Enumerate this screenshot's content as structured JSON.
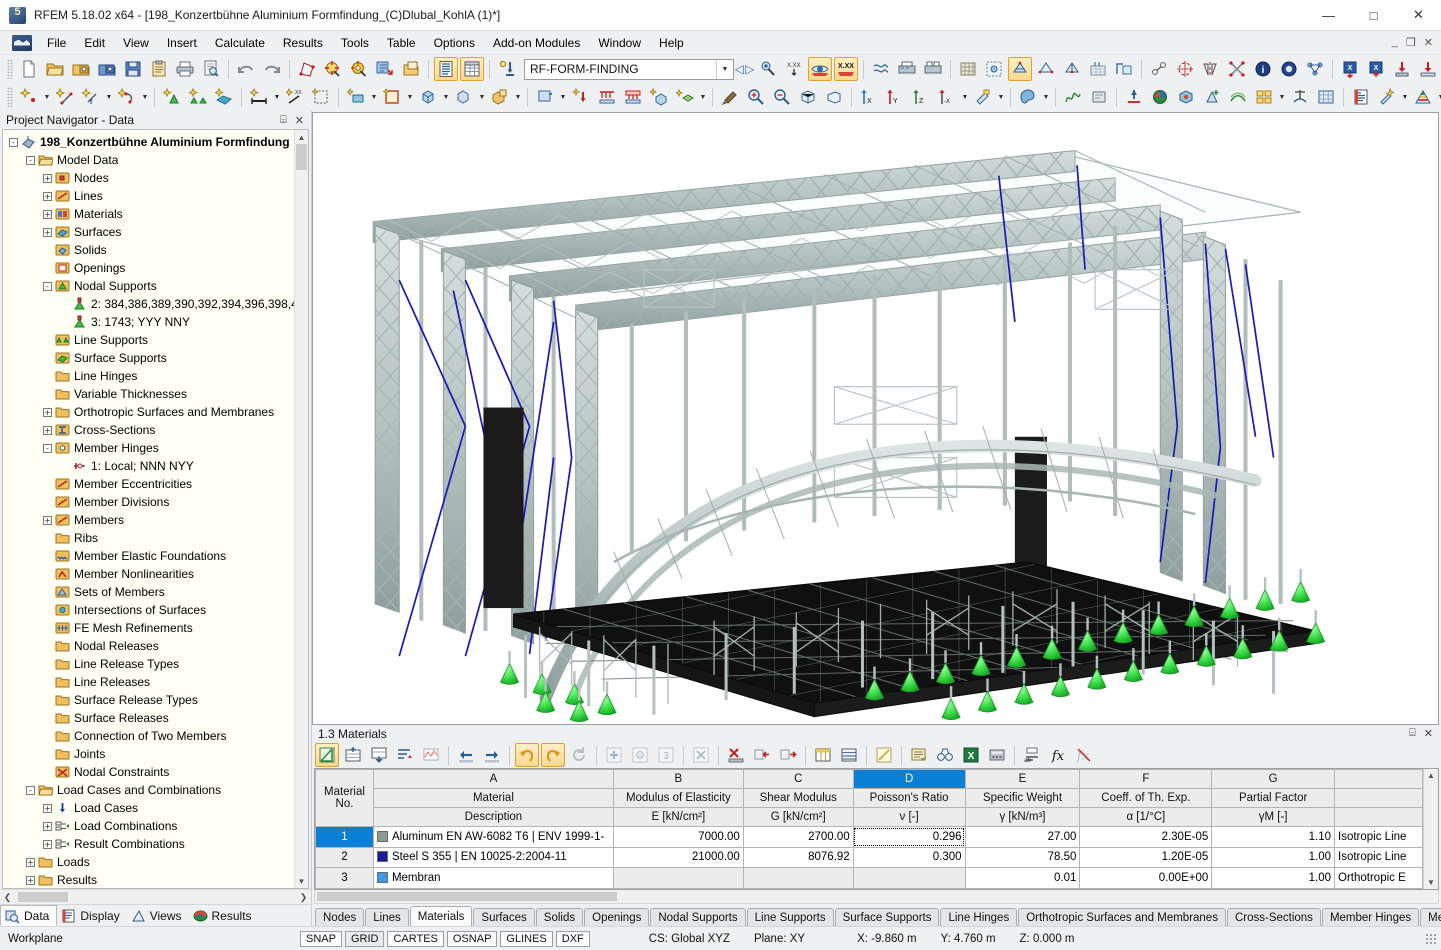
{
  "window": {
    "title": "RFEM 5.18.02 x64 - [198_Konzertbühne Aluminium Formfindung_(C)Dlubal_KohlA (1)*]",
    "minimize": "—",
    "maximize": "□",
    "close": "✕",
    "mdi_minimize": "_",
    "mdi_restore": "❐",
    "mdi_close": "✕"
  },
  "menu": {
    "items": [
      {
        "label": "File"
      },
      {
        "label": "Edit"
      },
      {
        "label": "View"
      },
      {
        "label": "Insert"
      },
      {
        "label": "Calculate"
      },
      {
        "label": "Results"
      },
      {
        "label": "Tools"
      },
      {
        "label": "Table"
      },
      {
        "label": "Options"
      },
      {
        "label": "Add-on Modules"
      },
      {
        "label": "Window"
      },
      {
        "label": "Help"
      }
    ]
  },
  "toolbar": {
    "loadcase_combo": "RF-FORM-FINDING",
    "row1_icons": [
      "new-file-icon",
      "open-folder-icon",
      "open-model-icon",
      "save-as-model-icon",
      "save-icon",
      "clipboard-icon",
      "print-icon",
      "print-preview-icon",
      "undo-icon",
      "redo-icon",
      "edit-model-icon",
      "select-node-icon",
      "circle-select-icon",
      "select-import-icon",
      "detail-icon",
      "tables-icon",
      "table-grid-icon",
      "load-wizard-icon"
    ],
    "row1_right_icons": [
      "prev-case-icon",
      "next-case-icon",
      "render-icon",
      "numeric-value-icon",
      "display-result-icon",
      "result-value-icon",
      "wind-simulation-icon",
      "printout-report-icon",
      "printout-list-icon",
      "mesh-icon",
      "mesh-settings-icon",
      "fe-mesh-icon",
      "calc-mesh-icon",
      "calc-all-icon",
      "calc-select-icon",
      "calc-diagram-icon",
      "snap-icon",
      "rotate-icon",
      "mirror-icon",
      "select-cross-icon",
      "info-icon",
      "check-icon",
      "network-icon",
      "export-xls-icon",
      "export-xls2-icon",
      "import-icon",
      "import2-icon"
    ],
    "row2_icons": [
      "new-node-icon",
      "new-line-icon",
      "new-dimension-icon",
      "new-polygon-icon",
      "new-nodal-support-icon",
      "new-line-support-icon",
      "new-surface-icon",
      "new-member-icon",
      "new-member-xx-icon",
      "new-select-region-icon",
      "new-surface-obj-icon",
      "new-opening-icon",
      "new-solid-icon",
      "new-solid-group-icon",
      "new-block-icon",
      "new-load-icon",
      "new-nodal-load-icon",
      "new-line-load-icon",
      "new-surface-load-icon",
      "new-free-load-icon",
      "new-loadwizard-icon",
      "cleanup-icon",
      "zoom-in-icon",
      "zoom-out-icon",
      "view-box-icon",
      "view-persp-icon",
      "axis-x-icon",
      "axis-y-icon",
      "axis-z-icon",
      "axis-xy-icon",
      "render-mode-icon",
      "paint-icon",
      "deform-icon",
      "time-icon",
      "support-reaction-icon",
      "color-result-icon",
      "solid-result-icon",
      "add-result-icon",
      "iso-result-icon",
      "panel-result-icon",
      "mesh-result-icon",
      "grid-result-icon",
      "report-icon",
      "settings-icon",
      "color-scale-icon"
    ]
  },
  "navigator": {
    "title": "Project Navigator - Data",
    "pin": "⌸",
    "close": "✕",
    "tree": [
      {
        "depth": 0,
        "toggle": "-",
        "icon": "model-icon",
        "label": "198_Konzertbühne Aluminium Formfindung",
        "bold": true
      },
      {
        "depth": 1,
        "toggle": "-",
        "icon": "folder-open-icon",
        "label": "Model Data"
      },
      {
        "depth": 2,
        "toggle": "+",
        "icon": "nodes-icon",
        "label": "Nodes"
      },
      {
        "depth": 2,
        "toggle": "+",
        "icon": "lines-icon",
        "label": "Lines"
      },
      {
        "depth": 2,
        "toggle": "+",
        "icon": "materials-icon",
        "label": "Materials"
      },
      {
        "depth": 2,
        "toggle": "+",
        "icon": "surfaces-icon",
        "label": "Surfaces"
      },
      {
        "depth": 2,
        "toggle": "",
        "icon": "solids-icon",
        "label": "Solids"
      },
      {
        "depth": 2,
        "toggle": "",
        "icon": "openings-icon",
        "label": "Openings"
      },
      {
        "depth": 2,
        "toggle": "-",
        "icon": "nodal-supports-icon",
        "label": "Nodal Supports"
      },
      {
        "depth": 3,
        "toggle": "",
        "icon": "support-item-icon",
        "label": "2: 384,386,389,390,392,394,396,398,4"
      },
      {
        "depth": 3,
        "toggle": "",
        "icon": "support-item-icon",
        "label": "3: 1743; YYY NNY"
      },
      {
        "depth": 2,
        "toggle": "",
        "icon": "line-supports-icon",
        "label": "Line Supports"
      },
      {
        "depth": 2,
        "toggle": "",
        "icon": "surface-supports-icon",
        "label": "Surface Supports"
      },
      {
        "depth": 2,
        "toggle": "",
        "icon": "line-hinges-icon",
        "label": "Line Hinges"
      },
      {
        "depth": 2,
        "toggle": "",
        "icon": "variable-thicknesses-icon",
        "label": "Variable Thicknesses"
      },
      {
        "depth": 2,
        "toggle": "+",
        "icon": "orthotropic-icon",
        "label": "Orthotropic Surfaces and Membranes"
      },
      {
        "depth": 2,
        "toggle": "+",
        "icon": "cross-sections-icon",
        "label": "Cross-Sections"
      },
      {
        "depth": 2,
        "toggle": "-",
        "icon": "member-hinges-icon",
        "label": "Member Hinges"
      },
      {
        "depth": 3,
        "toggle": "",
        "icon": "hinge-item-icon",
        "label": "1: Local; NNN NYY"
      },
      {
        "depth": 2,
        "toggle": "",
        "icon": "member-eccentricities-icon",
        "label": "Member Eccentricities"
      },
      {
        "depth": 2,
        "toggle": "",
        "icon": "member-divisions-icon",
        "label": "Member Divisions"
      },
      {
        "depth": 2,
        "toggle": "+",
        "icon": "members-icon",
        "label": "Members"
      },
      {
        "depth": 2,
        "toggle": "",
        "icon": "ribs-icon",
        "label": "Ribs"
      },
      {
        "depth": 2,
        "toggle": "",
        "icon": "member-elastic-foundations-icon",
        "label": "Member Elastic Foundations"
      },
      {
        "depth": 2,
        "toggle": "",
        "icon": "member-nonlinearities-icon",
        "label": "Member Nonlinearities"
      },
      {
        "depth": 2,
        "toggle": "",
        "icon": "sets-of-members-icon",
        "label": "Sets of Members"
      },
      {
        "depth": 2,
        "toggle": "",
        "icon": "intersections-icon",
        "label": "Intersections of Surfaces"
      },
      {
        "depth": 2,
        "toggle": "",
        "icon": "fe-mesh-refinements-icon",
        "label": "FE Mesh Refinements"
      },
      {
        "depth": 2,
        "toggle": "",
        "icon": "nodal-releases-icon",
        "label": "Nodal Releases"
      },
      {
        "depth": 2,
        "toggle": "",
        "icon": "line-release-types-icon",
        "label": "Line Release Types"
      },
      {
        "depth": 2,
        "toggle": "",
        "icon": "line-releases-icon",
        "label": "Line Releases"
      },
      {
        "depth": 2,
        "toggle": "",
        "icon": "surface-release-types-icon",
        "label": "Surface Release Types"
      },
      {
        "depth": 2,
        "toggle": "",
        "icon": "surface-releases-icon",
        "label": "Surface Releases"
      },
      {
        "depth": 2,
        "toggle": "",
        "icon": "connection-two-members-icon",
        "label": "Connection of Two Members"
      },
      {
        "depth": 2,
        "toggle": "",
        "icon": "joints-icon",
        "label": "Joints"
      },
      {
        "depth": 2,
        "toggle": "",
        "icon": "nodal-constraints-icon",
        "label": "Nodal Constraints"
      },
      {
        "depth": 1,
        "toggle": "-",
        "icon": "folder-open-icon",
        "label": "Load Cases and Combinations"
      },
      {
        "depth": 2,
        "toggle": "+",
        "icon": "load-cases-icon",
        "label": "Load Cases"
      },
      {
        "depth": 2,
        "toggle": "+",
        "icon": "load-combinations-icon",
        "label": "Load Combinations"
      },
      {
        "depth": 2,
        "toggle": "+",
        "icon": "result-combinations-icon",
        "label": "Result Combinations"
      },
      {
        "depth": 1,
        "toggle": "+",
        "icon": "folder-icon",
        "label": "Loads"
      },
      {
        "depth": 1,
        "toggle": "+",
        "icon": "folder-icon",
        "label": "Results"
      }
    ],
    "tabs": [
      {
        "label": "Data",
        "icon": "data-icon",
        "selected": true
      },
      {
        "label": "Display",
        "icon": "display-icon",
        "selected": false
      },
      {
        "label": "Views",
        "icon": "views-icon",
        "selected": false
      },
      {
        "label": "Results",
        "icon": "results-icon",
        "selected": false
      }
    ]
  },
  "table": {
    "title": "1.3 Materials",
    "pin": "⌸",
    "close": "✕",
    "toolbar_icons": [
      "edit-table-icon",
      "insert-row-icon",
      "move-down-icon",
      "sort-icon",
      "chart-icon",
      "prev-table-icon",
      "next-table-icon",
      "undo-table-icon",
      "redo-table-icon",
      "refresh-icon",
      "add-icon",
      "copy-icon",
      "info-row-icon",
      "delete-selected-icon",
      "delete-table-icon",
      "remove-row-icon",
      "insert-row2-icon",
      "columns-icon",
      "rows-icon",
      "edit-cell-icon",
      "print-table-icon",
      "binoculars-icon",
      "export-excel-icon",
      "calculator-icon",
      "autotext-icon",
      "formula-icon",
      "clear-formula-icon"
    ],
    "column_letters": [
      "",
      "A",
      "B",
      "C",
      "D",
      "E",
      "F",
      "G",
      ""
    ],
    "headers": [
      {
        "line1": "Material",
        "line2": "No."
      },
      {
        "line1": "Material",
        "line2": "Description"
      },
      {
        "line1": "Modulus of Elasticity",
        "line2": "E [kN/cm²]"
      },
      {
        "line1": "Shear Modulus",
        "line2": "G [kN/cm²]"
      },
      {
        "line1": "Poisson's Ratio",
        "line2": "ν [-]"
      },
      {
        "line1": "Specific Weight",
        "line2": "γ [kN/m³]"
      },
      {
        "line1": "Coeff. of Th. Exp.",
        "line2": "α [1/°C]"
      },
      {
        "line1": "Partial Factor",
        "line2": "γM [-]"
      },
      {
        "line1": "",
        "line2": ""
      }
    ],
    "selected_column": "D",
    "rows": [
      {
        "no": "1",
        "color": "#8f9a93",
        "description": "Aluminum EN AW-6082 T6 | ENV 1999-1-",
        "E": "7000.00",
        "G": "2700.00",
        "nu": "0.296",
        "gamma": "27.00",
        "alpha": "2.30E-05",
        "gammaM": "1.10",
        "model": "Isotropic Line",
        "selected": true
      },
      {
        "no": "2",
        "color": "#1a1a9c",
        "description": "Steel S 355 | EN 10025-2:2004-11",
        "E": "21000.00",
        "G": "8076.92",
        "nu": "0.300",
        "gamma": "78.50",
        "alpha": "1.20E-05",
        "gammaM": "1.00",
        "model": "Isotropic Line",
        "selected": false
      },
      {
        "no": "3",
        "color": "#3c9ae8",
        "description": "Membran",
        "E": "",
        "G": "",
        "nu": "",
        "gamma": "0.01",
        "alpha": "0.00E+00",
        "gammaM": "1.00",
        "model": "Orthotropic E",
        "selected": false
      }
    ],
    "sheet_tabs": [
      {
        "label": "Nodes",
        "selected": false
      },
      {
        "label": "Lines",
        "selected": false
      },
      {
        "label": "Materials",
        "selected": true
      },
      {
        "label": "Surfaces",
        "selected": false
      },
      {
        "label": "Solids",
        "selected": false
      },
      {
        "label": "Openings",
        "selected": false
      },
      {
        "label": "Nodal Supports",
        "selected": false
      },
      {
        "label": "Line Supports",
        "selected": false
      },
      {
        "label": "Surface Supports",
        "selected": false
      },
      {
        "label": "Line Hinges",
        "selected": false
      },
      {
        "label": "Orthotropic Surfaces and Membranes",
        "selected": false
      },
      {
        "label": "Cross-Sections",
        "selected": false
      },
      {
        "label": "Member Hinges",
        "selected": false
      },
      {
        "label": "Member Eccentricities",
        "selected": false
      }
    ],
    "tab_nav": [
      "|◀",
      "◀",
      "▶",
      "▶|"
    ]
  },
  "statusbar": {
    "workplane": "Workplane",
    "flags": [
      {
        "label": "SNAP",
        "active": true
      },
      {
        "label": "GRID",
        "active": false
      },
      {
        "label": "CARTES",
        "active": true
      },
      {
        "label": "OSNAP",
        "active": true
      },
      {
        "label": "GLINES",
        "active": true
      },
      {
        "label": "DXF",
        "active": true
      }
    ],
    "cs": "CS: Global XYZ",
    "plane": "Plane: XY",
    "x": "X:  -9.860 m",
    "y": "Y:  4.760 m",
    "z": "Z:  0.000 m"
  },
  "viewport": {
    "model_name": "Concert stage aluminium truss form-finding model",
    "colors": {
      "truss": "#b9c6c4",
      "truss_dark": "#8b9b99",
      "deck": "#141414",
      "support": "#3fdc4a",
      "cable": "#1a1ab4",
      "speaker": "#1c1c1c",
      "background": "#ffffff"
    }
  }
}
